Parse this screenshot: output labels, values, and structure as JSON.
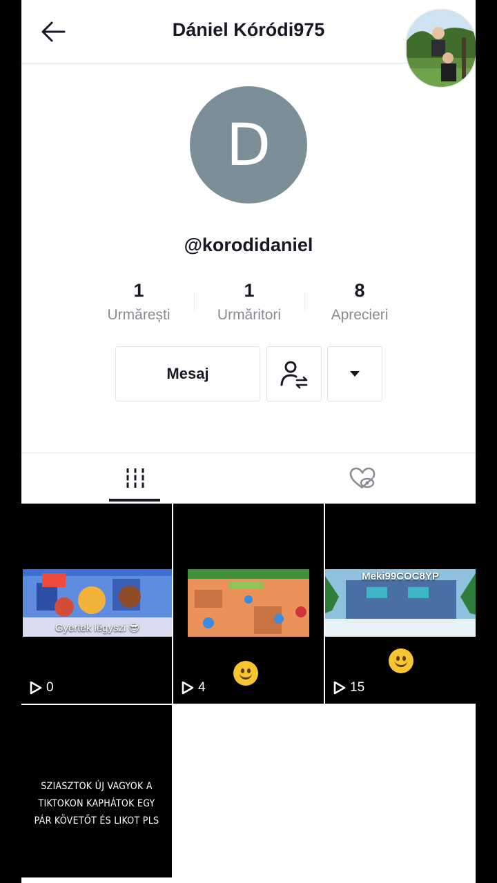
{
  "header": {
    "title": "Dániel Kóródi975"
  },
  "profile": {
    "avatar_letter": "D",
    "avatar_color": "#7c8f99",
    "username": "@korodidaniel",
    "stats": [
      {
        "value": "1",
        "label": "Urmărești"
      },
      {
        "value": "1",
        "label": "Urmăritori"
      },
      {
        "value": "8",
        "label": "Aprecieri"
      }
    ],
    "message_label": "Mesaj"
  },
  "tabs": [
    {
      "icon": "grid-icon",
      "selected": true
    },
    {
      "icon": "liked-hidden-icon",
      "selected": false
    }
  ],
  "videos": [
    {
      "views": "0",
      "caption": "Gyertek légyszi 😎"
    },
    {
      "views": "4",
      "caption": ""
    },
    {
      "views": "15",
      "caption": "Meki99COC8YP"
    },
    {
      "views": "",
      "caption": "SZIASZTOK ÚJ VAGYOK A TIKTOKON KAPHÁTOK EGY PÁR KÖVETŐT ÉS LIKOT PLS"
    }
  ]
}
